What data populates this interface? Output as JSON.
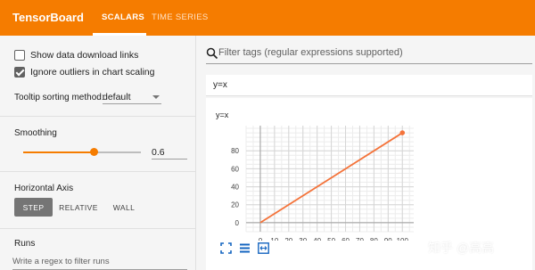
{
  "header": {
    "brand": "TensorBoard",
    "tabs": [
      {
        "label": "SCALARS",
        "active": true
      },
      {
        "label": "TIME SERIES",
        "active": false
      }
    ],
    "color": "#f57c00"
  },
  "sidebar": {
    "checkboxes": [
      {
        "label": "Show data download links",
        "checked": false
      },
      {
        "label": "Ignore outliers in chart scaling",
        "checked": true
      }
    ],
    "tooltip": {
      "label": "Tooltip sorting method:",
      "value": "default"
    },
    "smoothing": {
      "title": "Smoothing",
      "value": "0.6",
      "fraction": 0.6
    },
    "horizontal_axis": {
      "title": "Horizontal Axis",
      "options": [
        "STEP",
        "RELATIVE",
        "WALL"
      ],
      "selected": "STEP"
    },
    "runs": {
      "title": "Runs",
      "placeholder": "Write a regex to filter runs"
    }
  },
  "main": {
    "search_placeholder": "Filter tags (regular expressions supported)",
    "card_tag": "y=x",
    "chart_title": "y=x"
  },
  "watermark": "知乎 @高高",
  "chart_data": {
    "type": "line",
    "title": "y=x",
    "x": [
      0,
      100
    ],
    "y": [
      0,
      100
    ],
    "xticks": [
      0,
      10,
      20,
      30,
      40,
      50,
      60,
      70,
      80,
      90,
      100
    ],
    "yticks": [
      0,
      20,
      40,
      60,
      80
    ],
    "xlim": [
      -10,
      108
    ],
    "ylim": [
      -10,
      108
    ],
    "grid": true,
    "line_color": "#f4733a"
  }
}
